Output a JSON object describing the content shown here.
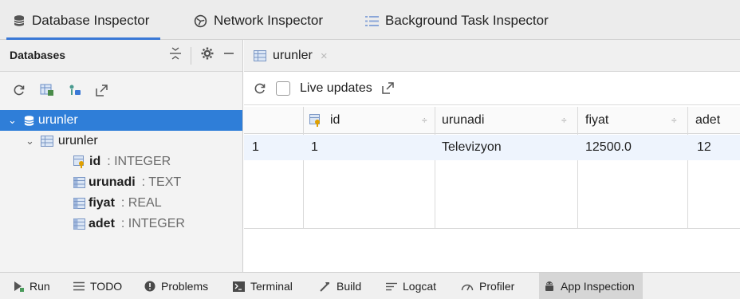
{
  "inspector_tabs": [
    {
      "label": "Database Inspector",
      "icon": "database-icon",
      "active": true
    },
    {
      "label": "Network Inspector",
      "icon": "network-icon",
      "active": false
    },
    {
      "label": "Background Task Inspector",
      "icon": "list-icon",
      "active": false
    }
  ],
  "left_panel": {
    "title": "Databases",
    "tools": [
      "collapse-all-icon",
      "gear-icon",
      "minimize-icon"
    ],
    "actions": [
      "refresh-icon",
      "new-query-icon",
      "keep-connection-icon",
      "export-icon"
    ]
  },
  "tree": {
    "database": "urunler",
    "table": "urunler",
    "columns": [
      {
        "name": "id",
        "type": ": INTEGER",
        "primary_key": true
      },
      {
        "name": "urunadi",
        "type": ": TEXT",
        "primary_key": false
      },
      {
        "name": "fiyat",
        "type": ": REAL",
        "primary_key": false
      },
      {
        "name": "adet",
        "type": ": INTEGER",
        "primary_key": false
      }
    ]
  },
  "editor_tab": {
    "label": "urunler",
    "close": "×"
  },
  "toolbar": {
    "live_updates_label": "Live updates",
    "live_updates_checked": false
  },
  "table_view": {
    "headers": [
      "id",
      "urunadi",
      "fiyat",
      "adet"
    ],
    "rows": [
      {
        "row_num": "1",
        "cells": [
          "1",
          "Televizyon",
          "12500.0",
          "12"
        ]
      }
    ],
    "sort_glyph": "÷"
  },
  "bottom_tabs": [
    {
      "label": "Run",
      "icon": "run-icon",
      "active": false
    },
    {
      "label": "TODO",
      "icon": "todo-icon",
      "active": false
    },
    {
      "label": "Problems",
      "icon": "problems-icon",
      "active": false
    },
    {
      "label": "Terminal",
      "icon": "terminal-icon",
      "active": false
    },
    {
      "label": "Build",
      "icon": "build-icon",
      "active": false
    },
    {
      "label": "Logcat",
      "icon": "logcat-icon",
      "active": false
    },
    {
      "label": "Profiler",
      "icon": "profiler-icon",
      "active": false
    },
    {
      "label": "App Inspection",
      "icon": "app-inspection-icon",
      "active": true
    }
  ],
  "colors": {
    "accent": "#3a78d6",
    "selection": "#2f7ed8",
    "row_highlight": "#eef4fd"
  }
}
